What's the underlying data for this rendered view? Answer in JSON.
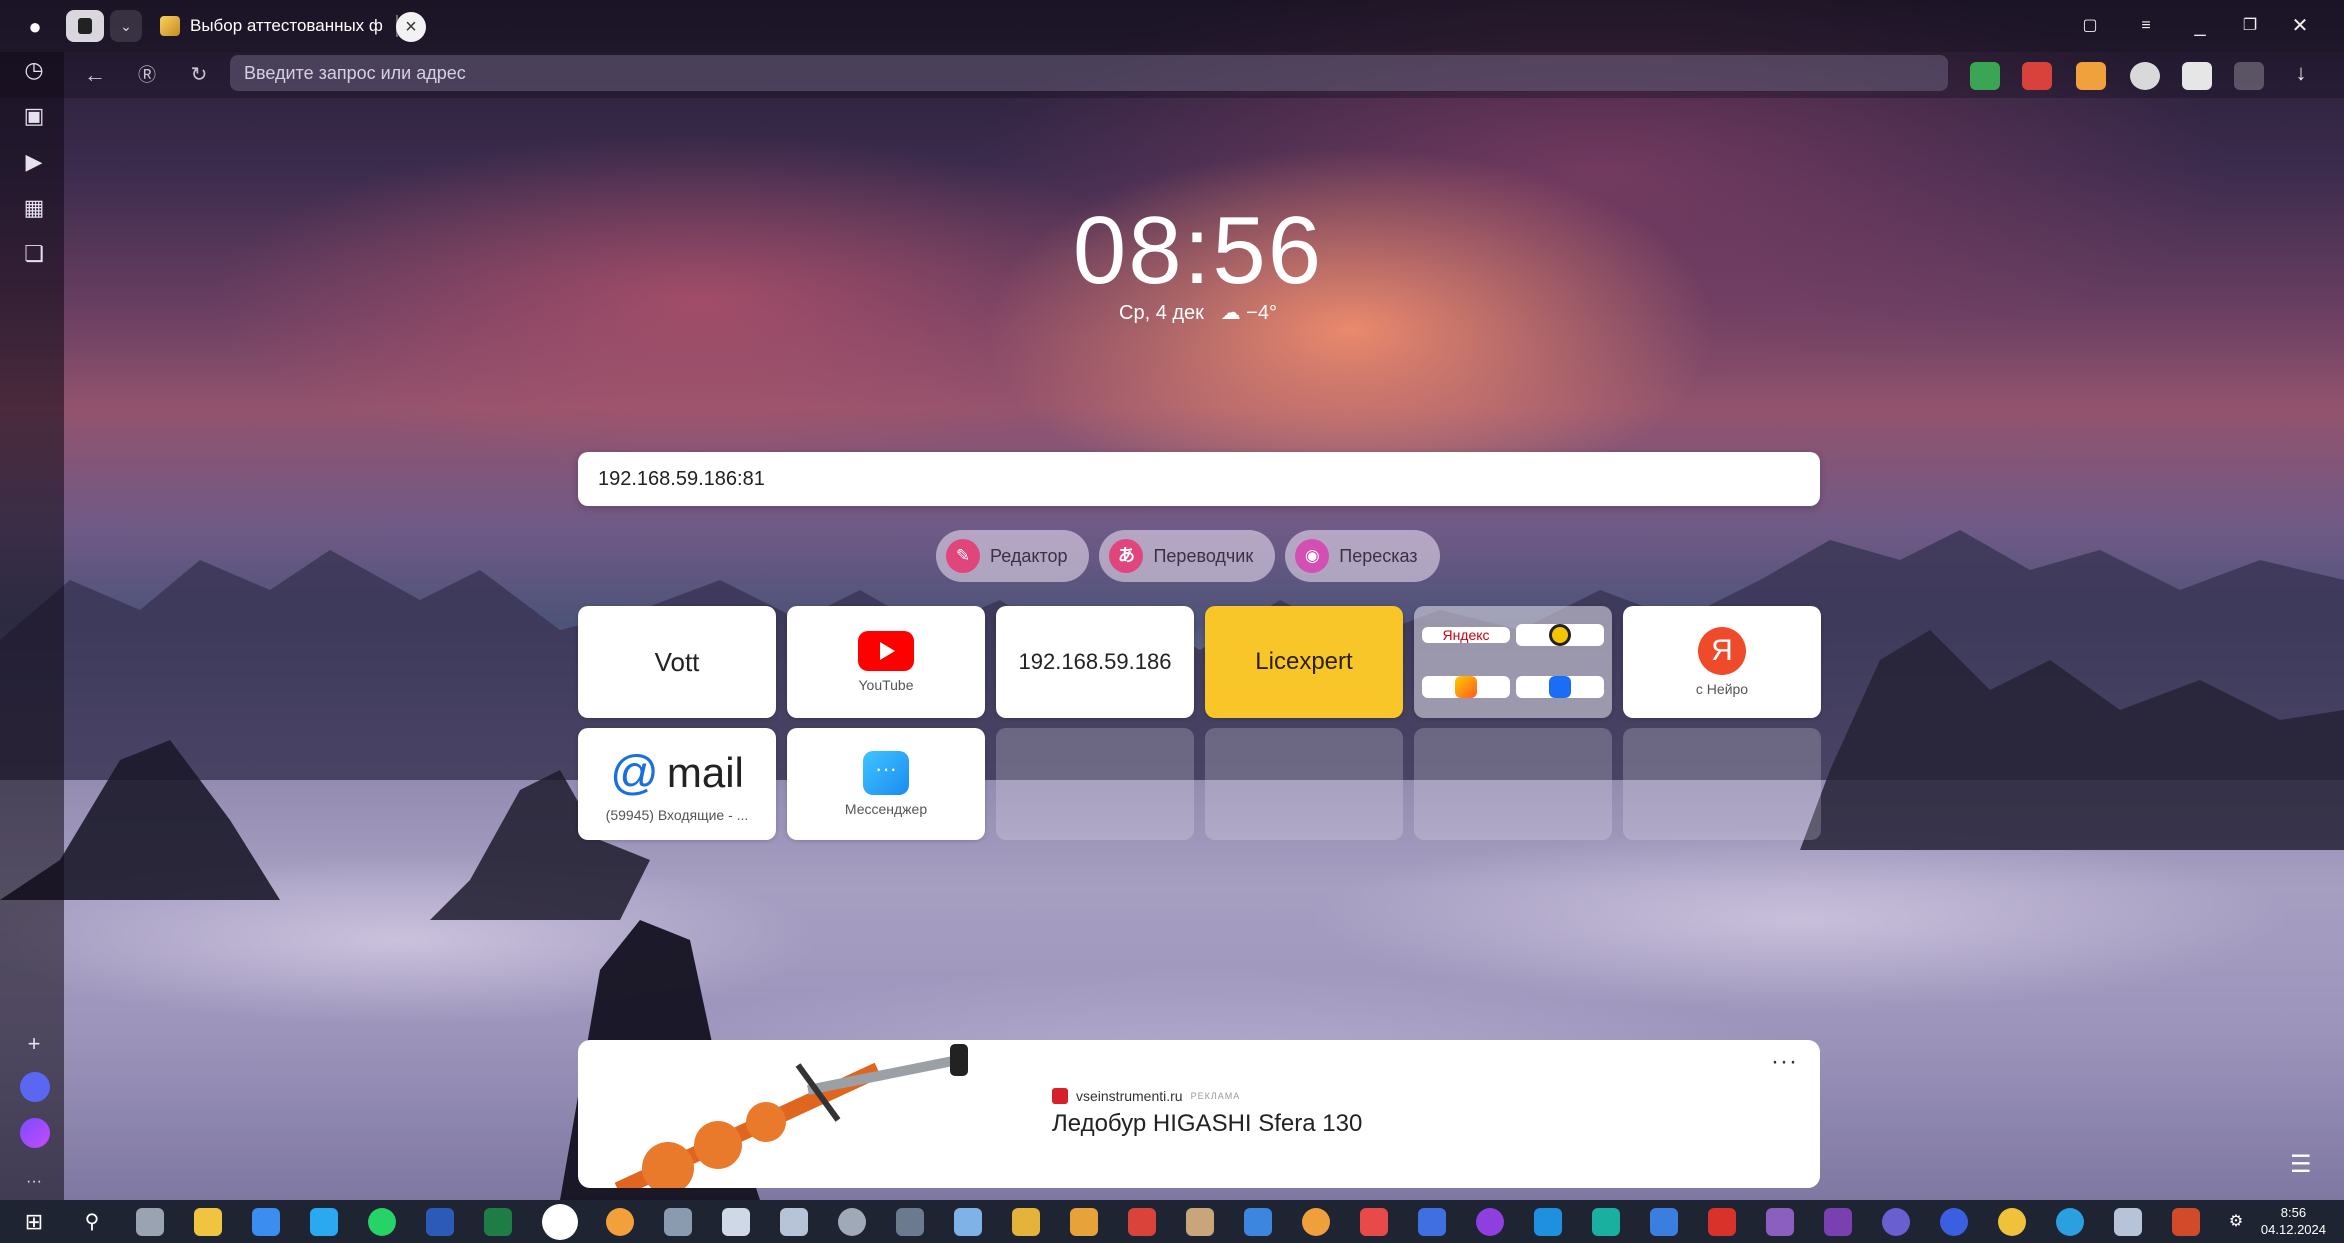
{
  "tab": {
    "title": "Выбор аттестованных ф"
  },
  "omnibox": {
    "placeholder": "Введите запрос или адрес"
  },
  "clock": {
    "time": "08:56",
    "date": "Ср, 4 дек",
    "weather": "−4°"
  },
  "search": {
    "value": "192.168.59.186:81"
  },
  "tools": [
    {
      "label": "Редактор",
      "icon": "editor-icon",
      "color": "#e0457b"
    },
    {
      "label": "Переводчик",
      "icon": "translate-icon",
      "color": "#e0457b"
    },
    {
      "label": "Пересказ",
      "icon": "retell-icon",
      "color": "#d34fb4"
    }
  ],
  "tiles": {
    "vott": {
      "title": "Vott"
    },
    "youtube": {
      "caption": "YouTube"
    },
    "ip": {
      "title": "192.168.59.186"
    },
    "licexpert": {
      "title": "Licexpert"
    },
    "yandex_group": {
      "cell1": "Яндекс"
    },
    "neuro": {
      "caption": "с Нейро",
      "logo": "Я"
    },
    "mail": {
      "logo": "mail",
      "caption": "(59945) Входящие - ..."
    },
    "messenger": {
      "caption": "Мессенджер"
    }
  },
  "ad": {
    "source": "vseinstrumenti.ru",
    "tag": "РЕКЛАМА",
    "headline": "Ледобур HIGASHI Sfera 130",
    "more": "···"
  },
  "taskbar": {
    "time": "8:56",
    "date": "04.12.2024"
  },
  "colors": {
    "accent": "#f8c628",
    "youtube": "#ff0000",
    "mail": "#1a6fe0",
    "neuro": "#ef4b2b"
  }
}
